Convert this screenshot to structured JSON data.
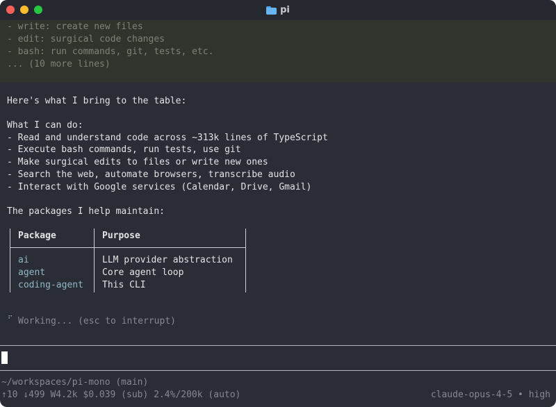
{
  "window": {
    "title": "pi",
    "title_icon": "folder-icon",
    "buttons": [
      "close",
      "minimize",
      "maximize"
    ]
  },
  "tool_output": {
    "lines": [
      "- write: create new files",
      "- edit: surgical code changes",
      "- bash: run commands, git, tests, etc.",
      "... (10 more lines)"
    ]
  },
  "message": {
    "intro": "Here's what I bring to the table:",
    "can_do_heading": "What I can do:",
    "can_do": [
      "- Read and understand code across ~313k lines of TypeScript",
      "- Execute bash commands, run tests, use git",
      "- Make surgical edits to files or write new ones",
      "- Search the web, automate browsers, transcribe audio",
      "- Interact with Google services (Calendar, Drive, Gmail)"
    ],
    "packages_heading": "The packages I help maintain:",
    "table": {
      "headers": [
        "Package",
        "Purpose"
      ],
      "rows": [
        {
          "package": "ai",
          "purpose": "LLM provider abstraction"
        },
        {
          "package": "agent",
          "purpose": "Core agent loop"
        },
        {
          "package": "coding-agent",
          "purpose": "This CLI"
        }
      ]
    }
  },
  "status": {
    "spinner": "⠋",
    "text": "Working... (esc to interrupt)"
  },
  "input": {
    "value": ""
  },
  "footer": {
    "path": "~/workspaces/pi-mono (main)",
    "stats": "↑10 ↓499 W4.2k $0.039 (sub) 2.4%/200k (auto)",
    "model": "claude-opus-4-5 • high"
  },
  "colors": {
    "background": "#2b2d36",
    "tool_block": "#2f342c",
    "accent": "#8fb7c6",
    "dim": "#858792"
  }
}
